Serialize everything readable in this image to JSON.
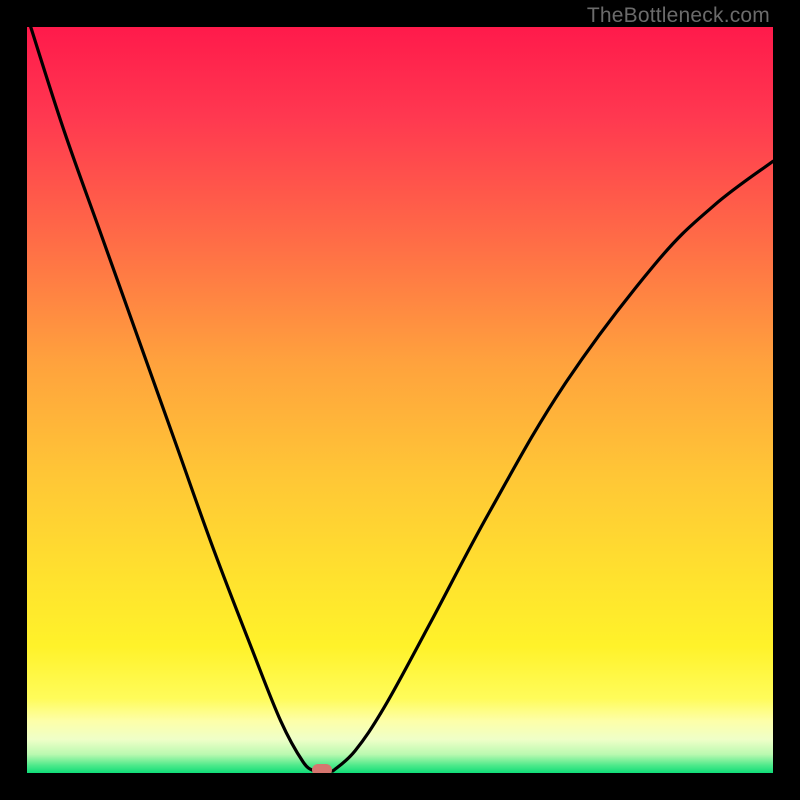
{
  "watermark": "TheBottleneck.com",
  "colors": {
    "black": "#000000",
    "curve": "#000000",
    "marker": "#d6756f",
    "gradient_stops": [
      {
        "offset": 0.0,
        "color": "#ff1a4b"
      },
      {
        "offset": 0.12,
        "color": "#ff3850"
      },
      {
        "offset": 0.28,
        "color": "#ff6a47"
      },
      {
        "offset": 0.45,
        "color": "#ffa23d"
      },
      {
        "offset": 0.6,
        "color": "#ffc636"
      },
      {
        "offset": 0.74,
        "color": "#ffe22e"
      },
      {
        "offset": 0.83,
        "color": "#fff22a"
      },
      {
        "offset": 0.9,
        "color": "#fffc5a"
      },
      {
        "offset": 0.93,
        "color": "#fdffa8"
      },
      {
        "offset": 0.955,
        "color": "#efffc8"
      },
      {
        "offset": 0.975,
        "color": "#baf9b0"
      },
      {
        "offset": 0.99,
        "color": "#4ce98a"
      },
      {
        "offset": 1.0,
        "color": "#0fdc78"
      }
    ]
  },
  "chart_data": {
    "type": "line",
    "title": "",
    "xlabel": "",
    "ylabel": "",
    "xlim": [
      0,
      1
    ],
    "ylim": [
      0,
      1
    ],
    "series": [
      {
        "name": "left-branch",
        "x": [
          0.005,
          0.05,
          0.1,
          0.15,
          0.2,
          0.25,
          0.3,
          0.34,
          0.37,
          0.385
        ],
        "values": [
          1.0,
          0.86,
          0.72,
          0.58,
          0.44,
          0.3,
          0.17,
          0.07,
          0.015,
          0.0
        ]
      },
      {
        "name": "right-branch",
        "x": [
          0.41,
          0.44,
          0.48,
          0.54,
          0.62,
          0.72,
          0.84,
          0.92,
          1.0
        ],
        "values": [
          0.0,
          0.03,
          0.09,
          0.2,
          0.35,
          0.52,
          0.68,
          0.76,
          0.82
        ]
      }
    ],
    "marker": {
      "x": 0.395,
      "y": 0.003
    }
  }
}
